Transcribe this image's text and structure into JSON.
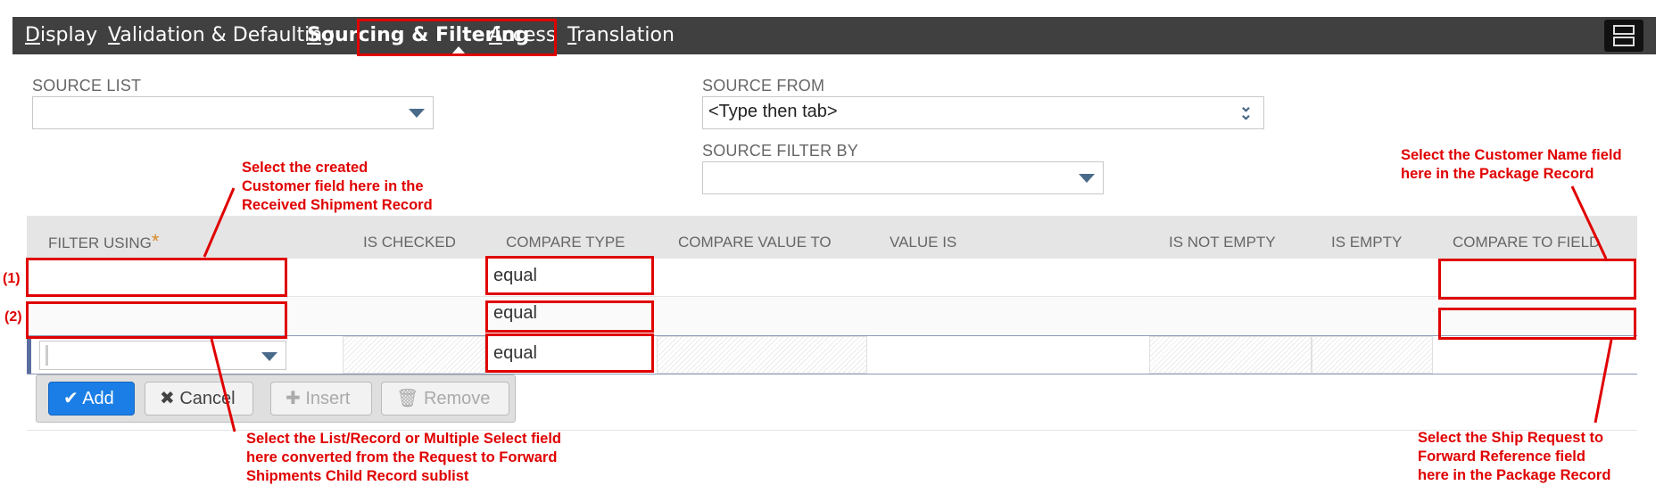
{
  "tabs": [
    {
      "accel": "D",
      "rest": "isplay",
      "active": false
    },
    {
      "accel": "V",
      "rest": "alidation & Defaulting",
      "active": false
    },
    {
      "accel": "S",
      "rest": "ourcing & Filtering",
      "active": true
    },
    {
      "accel": "A",
      "rest": "ccess",
      "active": false
    },
    {
      "accel": "T",
      "rest": "ranslation",
      "active": false
    }
  ],
  "form": {
    "source_list_label": "SOURCE LIST",
    "source_list_value": "",
    "source_from_label": "SOURCE FROM",
    "source_from_value": "<Type then tab>",
    "source_filter_label": "SOURCE FILTER BY",
    "source_filter_value": ""
  },
  "grid": {
    "headers": {
      "filter_using": "FILTER USING",
      "is_checked": "IS CHECKED",
      "compare_type": "COMPARE TYPE",
      "compare_value_to": "COMPARE VALUE TO",
      "value_is": "VALUE IS",
      "is_not_empty": "IS NOT EMPTY",
      "is_empty": "IS EMPTY",
      "compare_to_field": "COMPARE TO FIELD"
    },
    "rows": [
      {
        "compare_type": "equal"
      },
      {
        "compare_type": "equal"
      },
      {
        "compare_type": "equal"
      }
    ]
  },
  "buttons": {
    "add": "Add",
    "cancel": "Cancel",
    "insert": "Insert",
    "remove": "Remove"
  },
  "annotations": {
    "row1": "(1)",
    "row2": "(2)",
    "top_left": [
      "Select the created",
      "Customer field here in the",
      "Received Shipment Record"
    ],
    "top_right": [
      "Select the Customer Name field",
      "here in the Package Record"
    ],
    "bottom_left": [
      "Select the List/Record or Multiple Select field",
      "here converted from the Request to Forward",
      "Shipments Child Record sublist"
    ],
    "bottom_right": [
      "Select the Ship Request to",
      "Forward Reference field",
      "here in the Package Record"
    ]
  },
  "colors": {
    "annotation": "#e00000",
    "tabbar": "#404040",
    "primary": "#1a7ee6"
  }
}
